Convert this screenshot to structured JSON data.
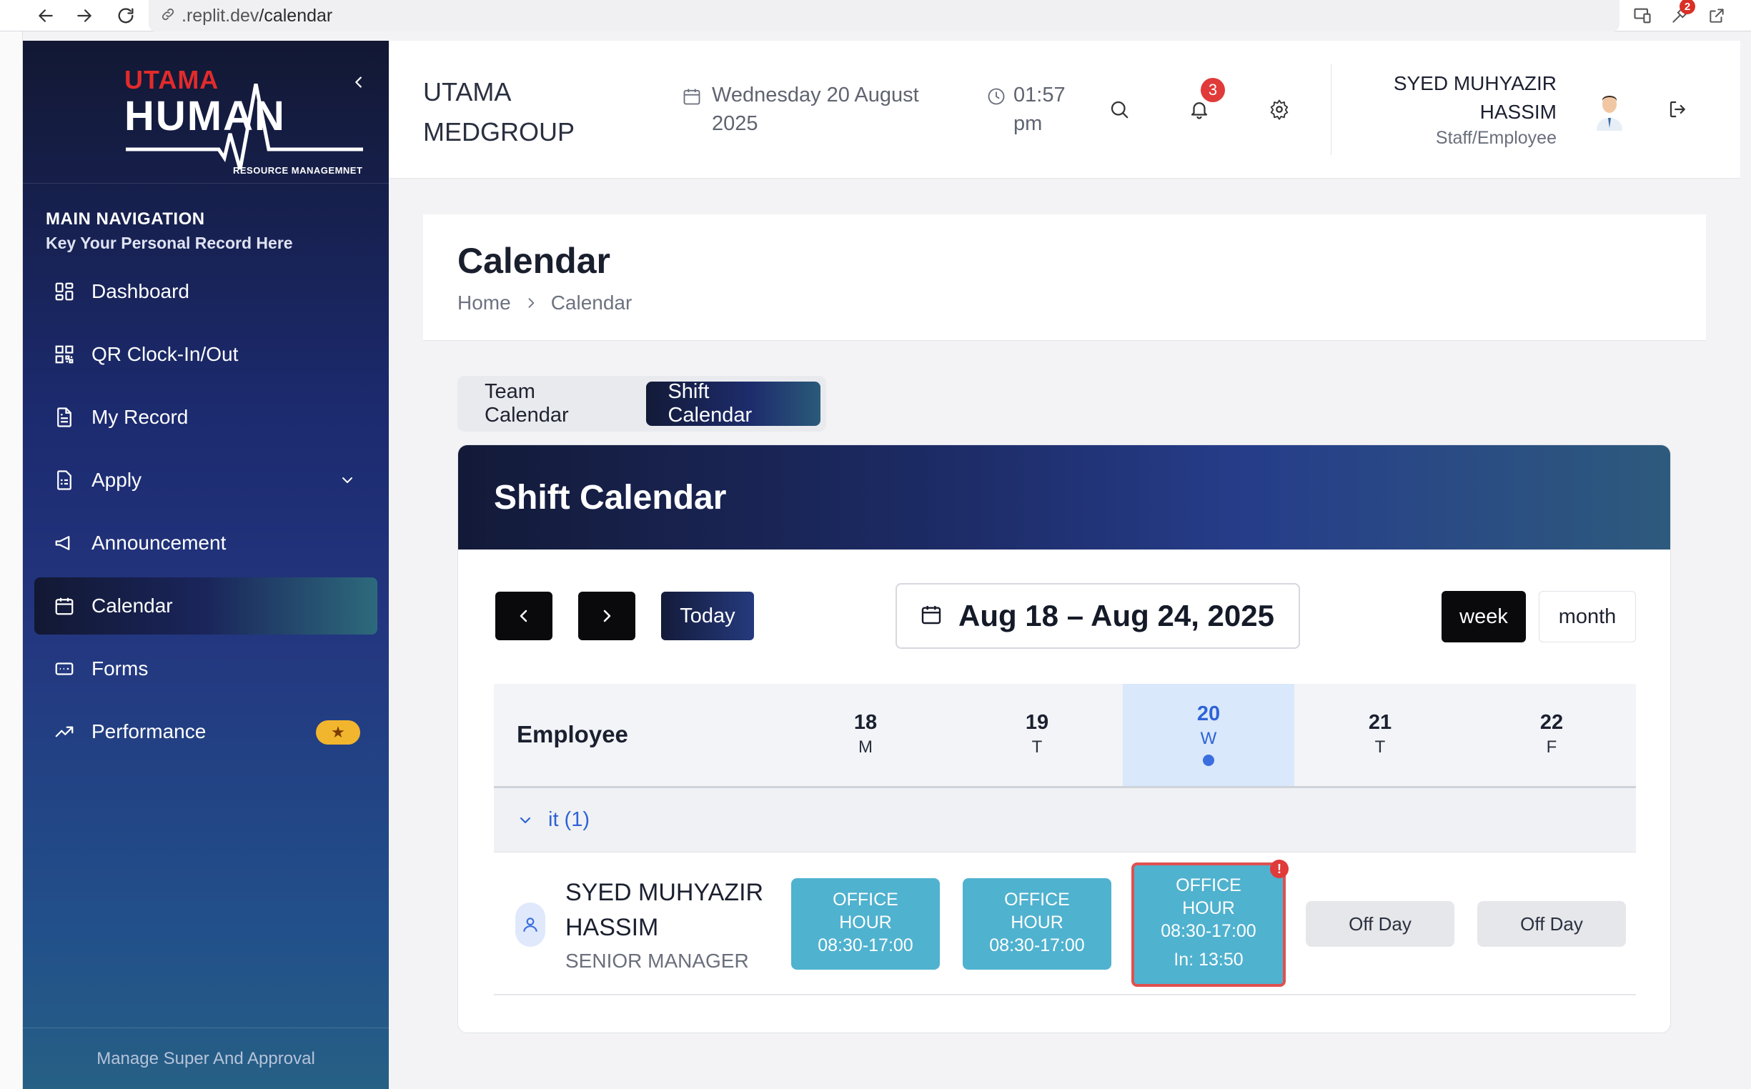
{
  "browser": {
    "url_prefix": ".replit.dev",
    "url_path": "/calendar",
    "extension_badge": "2"
  },
  "sidebar": {
    "logo_top": "UTAMA",
    "logo_main": "HUMAN",
    "logo_sub": "RESOURCE MANAGEMNET",
    "nav_title": "MAIN NAVIGATION",
    "nav_subtitle": "Key Your Personal Record Here",
    "items": [
      {
        "label": "Dashboard",
        "icon": "dashboard-icon"
      },
      {
        "label": "QR Clock-In/Out",
        "icon": "qr-code-icon"
      },
      {
        "label": "My Record",
        "icon": "document-icon"
      },
      {
        "label": "Apply",
        "icon": "form-document-icon"
      },
      {
        "label": "Announcement",
        "icon": "megaphone-icon"
      },
      {
        "label": "Calendar",
        "icon": "calendar-icon",
        "active": true
      },
      {
        "label": "Forms",
        "icon": "forms-icon"
      },
      {
        "label": "Performance",
        "icon": "trending-up-icon"
      }
    ],
    "footer": "Manage Super And Approval"
  },
  "header": {
    "company": "UTAMA MEDGROUP",
    "date": "Wednesday 20 August 2025",
    "time": "01:57 pm",
    "notification_count": "3",
    "user_name": "SYED MUHYAZIR HASSIM",
    "user_role": "Staff/Employee"
  },
  "page": {
    "title": "Calendar",
    "breadcrumb": [
      "Home",
      "Calendar"
    ]
  },
  "tabs": [
    {
      "label": "Team Calendar",
      "active": false
    },
    {
      "label": "Shift Calendar",
      "active": true
    }
  ],
  "shift_calendar": {
    "title": "Shift Calendar",
    "today_label": "Today",
    "range": "Aug 18 – Aug 24, 2025",
    "view_week": "week",
    "view_month": "month",
    "employee_header": "Employee",
    "days": [
      {
        "num": "18",
        "weekday": "M",
        "today": false
      },
      {
        "num": "19",
        "weekday": "T",
        "today": false
      },
      {
        "num": "20",
        "weekday": "W",
        "today": true
      },
      {
        "num": "21",
        "weekday": "T",
        "today": false
      },
      {
        "num": "22",
        "weekday": "F",
        "today": false
      }
    ],
    "group_label": "it (1)",
    "employee": {
      "name": "SYED MUHYAZIR HASSIM",
      "title": "SENIOR MANAGER"
    },
    "shifts": [
      {
        "line1": "OFFICE",
        "line2": "HOUR",
        "time": "08:30-17:00"
      },
      {
        "line1": "OFFICE",
        "line2": "HOUR",
        "time": "08:30-17:00"
      },
      {
        "line1": "OFFICE",
        "line2": "HOUR",
        "time": "08:30-17:00",
        "clock_in": "In: 13:50",
        "alert": "!"
      },
      {
        "off": "Off Day"
      },
      {
        "off": "Off Day"
      }
    ]
  },
  "colors": {
    "accent_blue": "#2f63d6",
    "shift_teal": "#4fb2cf",
    "alert_red": "#e03a3a",
    "star_yellow": "#f2b52e"
  }
}
